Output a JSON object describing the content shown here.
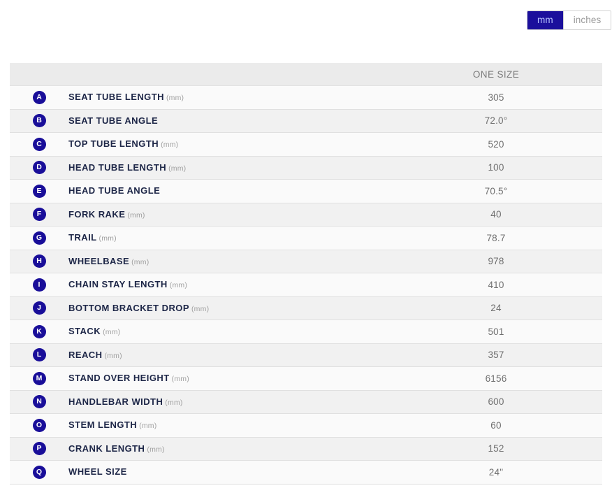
{
  "units": {
    "options": [
      {
        "id": "mm",
        "label": "mm",
        "active": true
      },
      {
        "id": "inches",
        "label": "inches",
        "active": false
      }
    ],
    "active_color": "#1b0f9c",
    "active_text_color": "#b9c4ff"
  },
  "table": {
    "columns": [
      "",
      "",
      "ONE SIZE"
    ],
    "size_header": "ONE SIZE",
    "badge_color": "#190e99",
    "label_color": "#1d2647",
    "value_color": "#6f6f6f",
    "rows": [
      {
        "badge": "A",
        "name": "SEAT TUBE LENGTH",
        "unit": "(mm)",
        "value": "305"
      },
      {
        "badge": "B",
        "name": "SEAT TUBE ANGLE",
        "unit": "",
        "value": "72.0°"
      },
      {
        "badge": "C",
        "name": "TOP TUBE LENGTH",
        "unit": "(mm)",
        "value": "520"
      },
      {
        "badge": "D",
        "name": "HEAD TUBE LENGTH",
        "unit": "(mm)",
        "value": "100"
      },
      {
        "badge": "E",
        "name": "HEAD TUBE ANGLE",
        "unit": "",
        "value": "70.5°"
      },
      {
        "badge": "F",
        "name": "FORK RAKE",
        "unit": "(mm)",
        "value": "40"
      },
      {
        "badge": "G",
        "name": "TRAIL",
        "unit": "(mm)",
        "value": "78.7"
      },
      {
        "badge": "H",
        "name": "WHEELBASE",
        "unit": "(mm)",
        "value": "978"
      },
      {
        "badge": "I",
        "name": "CHAIN STAY LENGTH",
        "unit": "(mm)",
        "value": "410"
      },
      {
        "badge": "J",
        "name": "BOTTOM BRACKET DROP",
        "unit": "(mm)",
        "value": "24"
      },
      {
        "badge": "K",
        "name": "STACK",
        "unit": "(mm)",
        "value": "501"
      },
      {
        "badge": "L",
        "name": "REACH",
        "unit": "(mm)",
        "value": "357"
      },
      {
        "badge": "M",
        "name": "STAND OVER HEIGHT",
        "unit": "(mm)",
        "value": "6156"
      },
      {
        "badge": "N",
        "name": "HANDLEBAR WIDTH",
        "unit": "(mm)",
        "value": "600"
      },
      {
        "badge": "O",
        "name": "STEM LENGTH",
        "unit": "(mm)",
        "value": "60"
      },
      {
        "badge": "P",
        "name": "CRANK LENGTH",
        "unit": "(mm)",
        "value": "152"
      },
      {
        "badge": "Q",
        "name": "WHEEL SIZE",
        "unit": "",
        "value": "24\""
      }
    ]
  }
}
